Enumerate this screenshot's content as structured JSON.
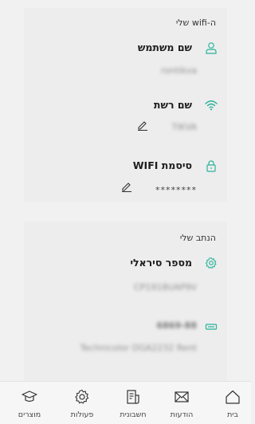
{
  "wifi_card": {
    "title": "ה-wifi שלי",
    "username_label": "שם משתמש",
    "username_value": "rontikva",
    "network_label": "שם רשת",
    "network_value": "TIKVA",
    "password_label": "סיסמת WIFI",
    "password_value": "********"
  },
  "router_card": {
    "title": "הנתב שלי",
    "serial_label": "מספר סיראלי",
    "serial_value": "CP1918UAP9V",
    "model_number": "6869-88",
    "model_name": "Technicolor DGA2232 Rent"
  },
  "nav": {
    "products": "מוצרים",
    "actions": "פעולות",
    "billing": "חשבונית",
    "messages": "הודעות",
    "home": "בית"
  },
  "colors": {
    "accent": "#2bb39b"
  }
}
